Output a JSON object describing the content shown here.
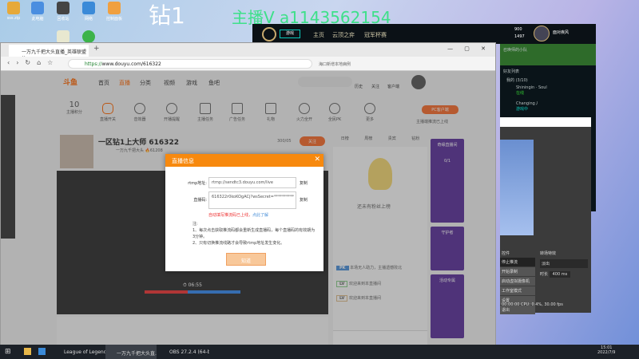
{
  "desktop": {
    "watermark_1": "钻1",
    "watermark_2": "主播V  a1143562154",
    "icons": [
      "sss.zip",
      "此电脑",
      "回收站",
      "网络",
      "控制面板",
      "文档",
      "微信"
    ]
  },
  "lol": {
    "tab": "游戏",
    "nav": [
      "主页",
      "云顶之弈",
      "冠军杯赛"
    ],
    "currency": [
      "900",
      "1497"
    ],
    "player_name": "面对疾风",
    "party_label": "召唤师的小队",
    "friends_header": "好友列表",
    "group": "我的 (3/10)",
    "friends": [
      {
        "name": "Shiningin · Soul",
        "status": "在线"
      },
      {
        "name": "Changing丿",
        "status": "游戏中"
      }
    ]
  },
  "obs": {
    "controls_header": "控件",
    "transition_header": "转场特效",
    "buttons": [
      "停止推流",
      "开始录制",
      "启动虚拟摄像机",
      "工作室模式",
      "设置",
      "退出"
    ],
    "transition": "淡出",
    "duration_label": "时长",
    "duration": "400 ms",
    "status": "00:00:00  CPU: 0.4%, 30.00 fps"
  },
  "browser": {
    "tab_title": "一万九千把大头直播_英雄联盟",
    "url_prefix": "https://",
    "url": "www.douyu.com/616322",
    "search_placeholder": "海口新增本地病例"
  },
  "douyu": {
    "nav": [
      "首页",
      "直播",
      "分类",
      "视频",
      "游戏",
      "鱼吧"
    ],
    "header_icons": [
      "历史",
      "关注",
      "客户端"
    ],
    "tools": [
      {
        "label": "主播积分",
        "value": "10"
      },
      {
        "label": "直播开关"
      },
      {
        "label": "音效器"
      },
      {
        "label": "开播提醒"
      },
      {
        "label": "主播任务"
      },
      {
        "label": "广告任务"
      },
      {
        "label": "礼物"
      },
      {
        "label": "火力全开"
      },
      {
        "label": "全民PK"
      },
      {
        "label": "更多"
      }
    ],
    "pc_button": "PC客户端",
    "pc_note": "主播端推流已上线",
    "room_title": "一区钻1上大师 616322",
    "streamer": "一万九千把大头",
    "heat": "61208",
    "follow": "关注",
    "follow_count": "300/05",
    "rank_tabs": [
      "日榜",
      "周榜",
      "贵宾",
      "钻粉"
    ],
    "chat_tip": "还未有粉丝上榜",
    "time": "06:55",
    "chat": [
      {
        "badge": "PK",
        "text": "本场无人助力，主播遗憾败北"
      },
      {
        "badge": "LV",
        "text": "欢迎来到本直播间"
      },
      {
        "badge": "LV",
        "text": "欢迎来到本直播间"
      }
    ],
    "promos": [
      "奇缘直播间",
      "0/1",
      "守护者",
      "活动专属"
    ]
  },
  "dialog": {
    "title": "直播信息",
    "rtmp_label": "rtmp地址:",
    "rtmp_value": "rtmp://sendtc3.douyu.com/live",
    "code_label": "直播码:",
    "code_value": "616322r0koKOgACj?wsSecret=**********",
    "copy": "复制",
    "warning": "自动填写推流码已上线，",
    "learn_more": "点此了解",
    "note_title": "注:",
    "notes": [
      "1、每次点击获取推流码都会重新生成直播码，每个直播码的有效期为3分钟。",
      "2、只有切换推流线路才会导致rtmp地址发生变化。"
    ],
    "ok": "知道"
  },
  "taskbar": {
    "items": [
      "League of Legends",
      "一万九千把大头直...",
      "OBS 27.2.4 (64-bi..."
    ],
    "time": "15:01",
    "date": "2022/7/9"
  }
}
